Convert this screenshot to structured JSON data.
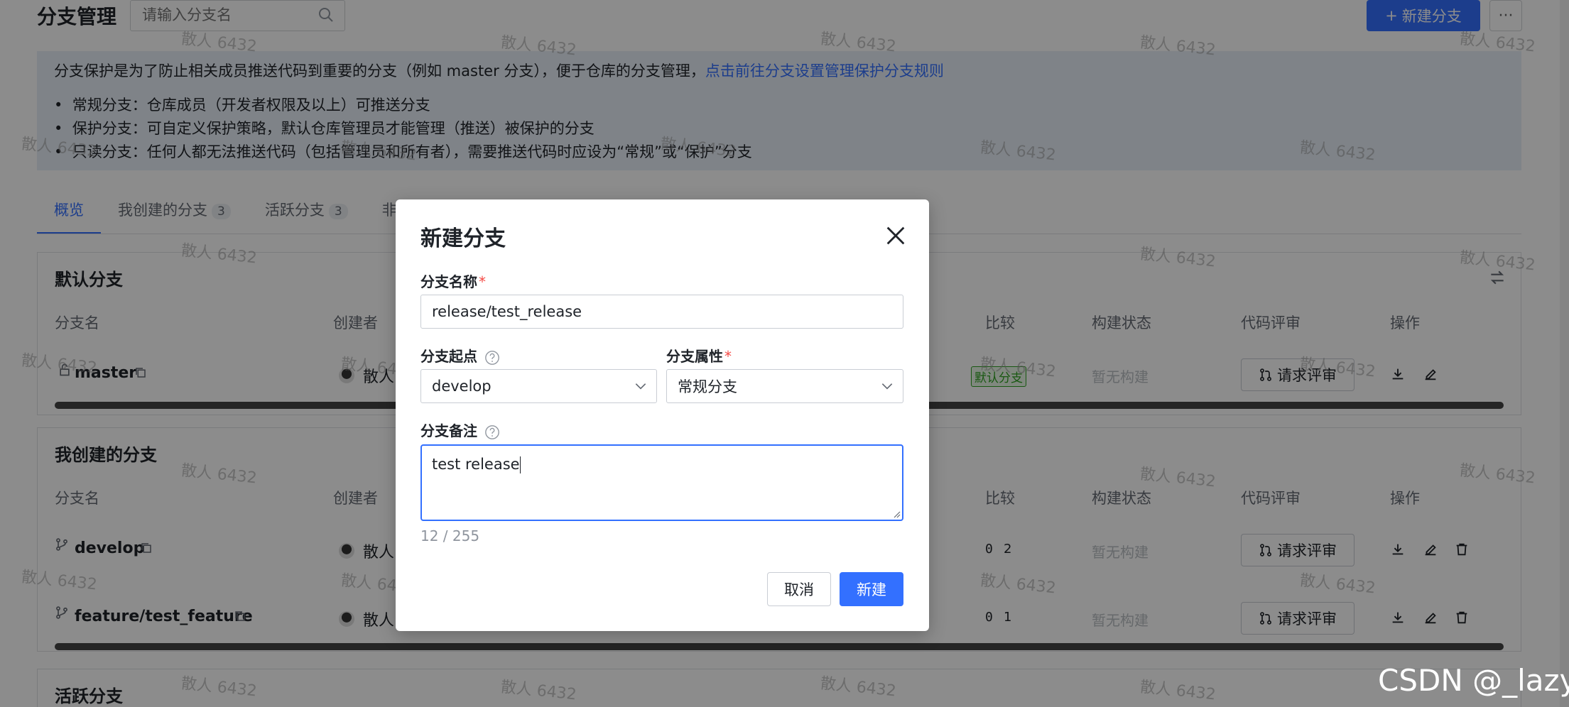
{
  "header": {
    "title": "分支管理",
    "search_placeholder": "请输入分支名",
    "new_branch_label": "新建分支",
    "more_label": "···"
  },
  "info": {
    "intro": "分支保护是为了防止相关成员推送代码到重要的分支（例如 master 分支），便于仓库的分支管理，",
    "link": "点击前往分支设置管理保护分支规则",
    "bullets": [
      "常规分支：仓库成员（开发者权限及以上）可推送分支",
      "保护分支：可自定义保护策略，默认仓库管理员才能管理（推送）被保护的分支",
      "只读分支：任何人都无法推送代码（包括管理员和所有者），需要推送代码时应设为“常规”或“保护”分支"
    ]
  },
  "tabs": [
    {
      "label": "概览",
      "count": ""
    },
    {
      "label": "我创建的分支",
      "count": "3"
    },
    {
      "label": "活跃分支",
      "count": "3"
    },
    {
      "label": "非",
      "count": ""
    }
  ],
  "columns": {
    "name": "分支名",
    "creator": "创建者",
    "compare": "比较",
    "build": "构建状态",
    "review": "代码评审",
    "ops": "操作"
  },
  "sections": {
    "default": {
      "title": "默认分支",
      "rows": [
        {
          "name": "master",
          "creator": "散人",
          "tag": "默认分支",
          "build": "暂无构建",
          "review": "请求评审"
        }
      ]
    },
    "mine": {
      "title": "我创建的分支",
      "rows": [
        {
          "name": "develop",
          "creator": "散人",
          "behind": "0",
          "ahead": "2",
          "build": "暂无构建",
          "review": "请求评审"
        },
        {
          "name": "feature/test_feature",
          "creator": "散人",
          "behind": "0",
          "ahead": "1",
          "build": "暂无构建",
          "review": "请求评审"
        }
      ]
    },
    "active": {
      "title": "活跃分支"
    }
  },
  "dialog": {
    "title": "新建分支",
    "name_label": "分支名称",
    "name_value": "release/test_release",
    "source_label": "分支起点",
    "source_value": "develop",
    "type_label": "分支属性",
    "type_value": "常规分支",
    "note_label": "分支备注",
    "note_value": "test release",
    "char_count": "12 / 255",
    "cancel_label": "取消",
    "create_label": "新建"
  },
  "watermark_text": "散人 6432",
  "csdn_mark": "CSDN @_lazy.",
  "colors": {
    "primary": "#3370ff",
    "required": "#f54a45",
    "default_tag": "#2ea121",
    "info_bg": "#e8eff8"
  }
}
